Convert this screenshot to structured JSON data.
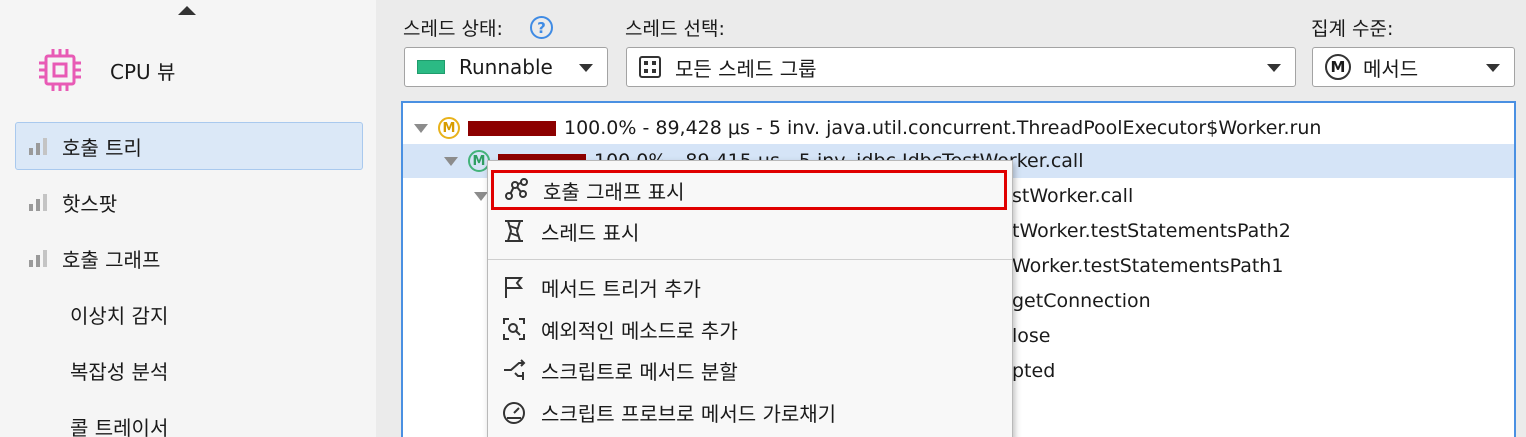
{
  "sidebar": {
    "title": "CPU 뷰",
    "items": [
      {
        "label": "호출 트리",
        "selected": true,
        "icon": "bar-chart-icon"
      },
      {
        "label": "핫스팟",
        "selected": false,
        "icon": "bar-chart-icon"
      },
      {
        "label": "호출 그래프",
        "selected": false,
        "icon": "bar-chart-icon"
      },
      {
        "label": "이상치 감지",
        "selected": false,
        "icon": null
      },
      {
        "label": "복잡성 분석",
        "selected": false,
        "icon": null
      },
      {
        "label": "콜 트레이서",
        "selected": false,
        "icon": null
      }
    ]
  },
  "toolbar": {
    "thread_state_label": "스레드 상태:",
    "thread_state_value": "Runnable",
    "thread_select_label": "스레드 선택:",
    "thread_select_value": "모든 스레드 그룹",
    "aggregation_label": "집계 수준:",
    "aggregation_value": "메서드",
    "aggregation_badge": "M",
    "help_glyph": "?"
  },
  "tree": {
    "rows": [
      {
        "badge": "M",
        "badge_color": "yellow",
        "percent_bar": 1.0,
        "text": "100.0% - 89,428 μs - 5 inv. java.util.concurrent.ThreadPoolExecutor$Worker.run"
      },
      {
        "badge": "M",
        "badge_color": "green",
        "percent_bar": 0.9999,
        "text": "100.0% - 89,415 μs - 5 inv. jdbc.JdbcTestWorker.call"
      },
      {
        "text": "stWorker.call"
      },
      {
        "text": "tWorker.testStatementsPath2"
      },
      {
        "text": "Worker.testStatementsPath1"
      },
      {
        "text": "getConnection"
      },
      {
        "text": "lose"
      },
      {
        "text": "pted"
      }
    ]
  },
  "context_menu": {
    "items": [
      {
        "label": "호출 그래프 표시",
        "icon": "graph-icon",
        "highlighted": true
      },
      {
        "label": "스레드 표시",
        "icon": "thread-spool-icon"
      },
      {
        "label": "메서드 트리거 추가",
        "icon": "flag-icon"
      },
      {
        "label": "예외적인 메소드로 추가",
        "icon": "inspect-icon"
      },
      {
        "label": "스크립트로 메서드 분할",
        "icon": "split-icon"
      },
      {
        "label": "스크립트 프로브로 메서드 가로채기",
        "icon": "gauge-icon"
      }
    ]
  },
  "colors": {
    "accent": "#4a90e2",
    "selection": "#d5e4f7",
    "percent_bar": "#8c0000",
    "runnable": "#2bba84",
    "highlight_box": "#e00000",
    "cpu_icon": "#e85ab5"
  }
}
